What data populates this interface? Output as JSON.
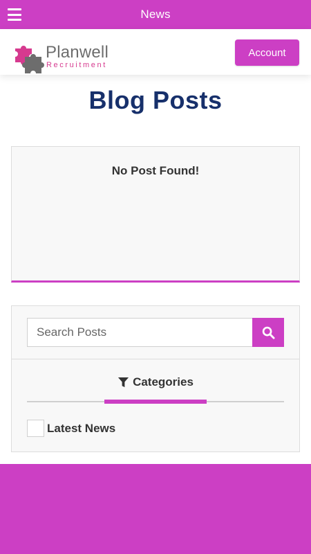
{
  "appbar": {
    "title": "News",
    "menu_icon": "hamburger-icon"
  },
  "header": {
    "logo_name": "Planwell",
    "logo_sub": "Recruitment",
    "account_label": "Account"
  },
  "page": {
    "title": "Blog Posts"
  },
  "posts": {
    "empty_message": "No Post Found!"
  },
  "sidebar": {
    "search_placeholder": "Search Posts",
    "search_value": "",
    "search_icon": "search-icon",
    "categories_title": "Categories",
    "categories_icon": "filter-icon",
    "categories": [
      {
        "label": "Latest News",
        "checked": false
      }
    ]
  },
  "colors": {
    "accent": "#cc3fc4",
    "title": "#17306b",
    "logo_pink": "#d63a8f",
    "logo_gray": "#6d6d6d"
  }
}
